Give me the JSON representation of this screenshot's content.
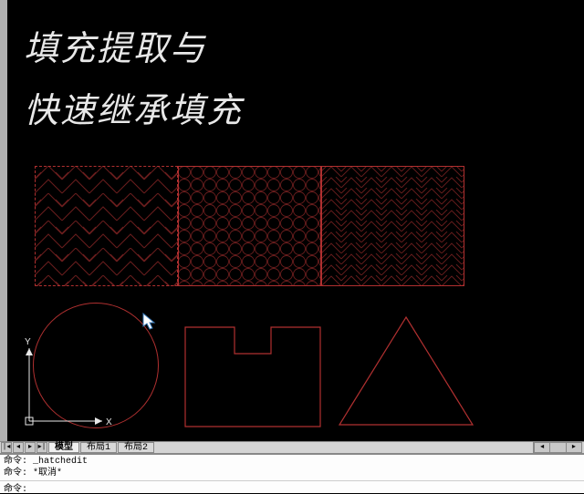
{
  "title": {
    "line1": "填充提取与",
    "line2": "快速继承填充"
  },
  "ucs": {
    "x_label": "X",
    "y_label": "Y"
  },
  "tabs": {
    "nav": [
      "|◂",
      "◂",
      "▸",
      "▸|"
    ],
    "items": [
      "模型",
      "布局1",
      "布局2"
    ],
    "active_index": 0,
    "scroll": [
      "◂",
      " ",
      "▸"
    ]
  },
  "command_log": [
    "命令: _hatchedit",
    "命令: *取消*"
  ],
  "command_prompt": "命令:",
  "command_input": "",
  "colors": {
    "shape": "#b03030",
    "ui_bg": "#d4d4d4",
    "text_light": "#e8e8e8"
  }
}
